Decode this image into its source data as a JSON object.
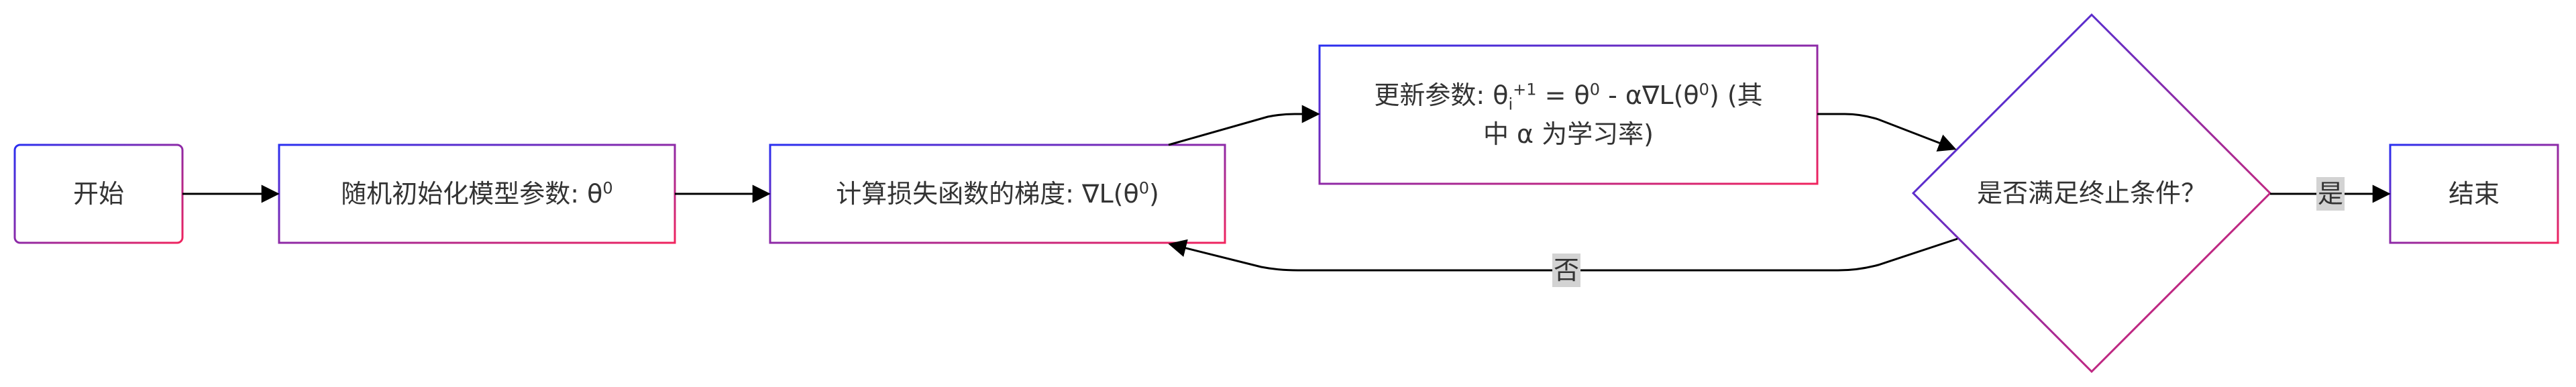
{
  "colors": {
    "gradient_start": "#2a2ff0",
    "gradient_end": "#f0245e",
    "edge": "#000000",
    "text": "#333333",
    "edge_label_bg": "#d3d3d3"
  },
  "nodes": {
    "start": {
      "label": "开始"
    },
    "init": {
      "label": "随机初始化模型参数: θ",
      "sup": "0"
    },
    "grad": {
      "label_a": "计算损失函数的梯度: ∇L(θ",
      "sup": "0",
      "label_b": ")"
    },
    "update": {
      "line1_a": "更新参数: θ",
      "line1_sub": "i",
      "line1_sup1": "+1",
      "line1_b": " = θ",
      "line1_sup2": "0",
      "line1_c": " - α∇L(θ",
      "line1_sup3": "0",
      "line1_d": ") (其",
      "line2": "中 α 为学习率)"
    },
    "decision": {
      "label": "是否满足终止条件？"
    },
    "end": {
      "label": "结束"
    }
  },
  "edges": {
    "yes_label": "是",
    "no_label": "否"
  }
}
